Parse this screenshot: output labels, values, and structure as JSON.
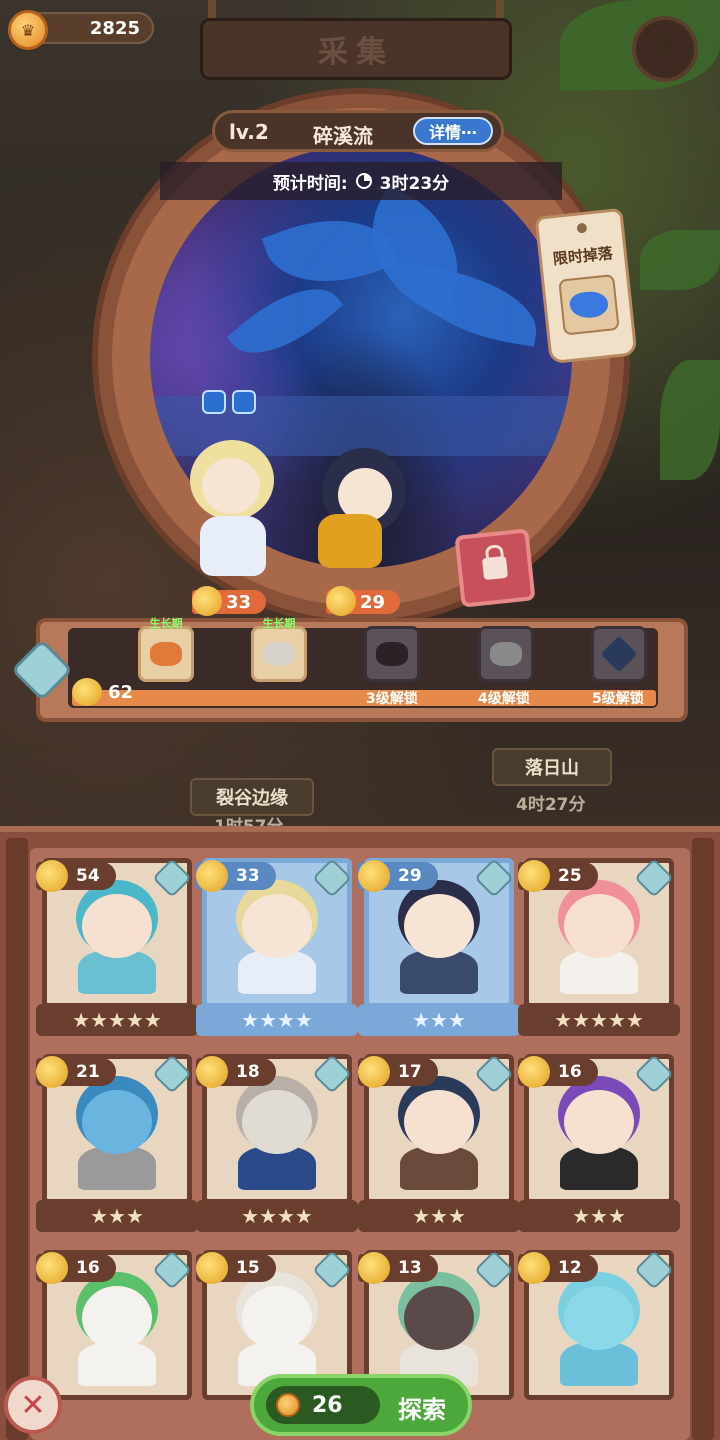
{
  "currency": {
    "coins": "2825"
  },
  "header": {
    "title": "采集",
    "help_icon": "question-icon"
  },
  "location": {
    "level": "lv.2",
    "name": "碎溪流",
    "detail_label": "详情⋯",
    "eta_label": "预计时间:",
    "eta_value": "3时23分",
    "limited_drop_label": "限时掉落"
  },
  "team": [
    {
      "power": "33"
    },
    {
      "power": "29"
    }
  ],
  "rewards": {
    "total_power": "62",
    "items": [
      {
        "stage": "生长期",
        "locked": false,
        "icon": "shell-icon",
        "color": "#e07a3a"
      },
      {
        "stage": "生长期",
        "locked": false,
        "icon": "ore-icon",
        "color": "#d8d4cc"
      },
      {
        "unlock": "3级解锁",
        "locked": true,
        "icon": "locked-item-icon"
      },
      {
        "unlock": "4级解锁",
        "locked": true,
        "icon": "locked-fish-icon"
      },
      {
        "unlock": "5级解锁",
        "locked": true,
        "icon": "locked-crystal-icon"
      }
    ]
  },
  "map": {
    "left_sign": "裂谷边缘",
    "left_time": "1时57分",
    "right_sign": "落日山",
    "right_time": "4时27分"
  },
  "characters": [
    {
      "power": "54",
      "stars": "★★★★★",
      "selected": false,
      "hair": "#4ab8c8",
      "skin": "#f8e0d0",
      "body": "#6ac0d0"
    },
    {
      "power": "33",
      "stars": "★★★★",
      "selected": true,
      "hair": "#e8d89a",
      "skin": "#f6e4d4",
      "body": "#e8eef8"
    },
    {
      "power": "29",
      "stars": "★★★",
      "selected": true,
      "hair": "#2a2e4a",
      "skin": "#f6e4d4",
      "body": "#3a4a6a"
    },
    {
      "power": "25",
      "stars": "★★★★★",
      "selected": false,
      "hair": "#f0909a",
      "skin": "#f8e0d0",
      "body": "#f4f0ec"
    },
    {
      "power": "21",
      "stars": "★★★",
      "selected": false,
      "hair": "#3a8ac0",
      "skin": "#6ab4e0",
      "body": "#9a9a9a"
    },
    {
      "power": "18",
      "stars": "★★★★",
      "selected": false,
      "hair": "#b8b0a8",
      "skin": "#e0dcd4",
      "body": "#2a4a8a"
    },
    {
      "power": "17",
      "stars": "★★★",
      "selected": false,
      "hair": "#2a3a5a",
      "skin": "#f6e0d0",
      "body": "#6a4a3a"
    },
    {
      "power": "16",
      "stars": "★★★",
      "selected": false,
      "hair": "#7a4ab8",
      "skin": "#f6e0d0",
      "body": "#2a2a2a"
    },
    {
      "power": "16",
      "stars": "",
      "selected": false,
      "hair": "#5ac06a",
      "skin": "#f4f2ee",
      "body": "#f4f2ee"
    },
    {
      "power": "15",
      "stars": "",
      "selected": false,
      "hair": "#e8e4dc",
      "skin": "#f4f2ee",
      "body": "#f4f2ee"
    },
    {
      "power": "13",
      "stars": "",
      "selected": false,
      "hair": "#7ac0a0",
      "skin": "#5a4a4a",
      "body": "#e8e4dc"
    },
    {
      "power": "12",
      "stars": "",
      "selected": false,
      "hair": "#7ad0e0",
      "skin": "#8ad8e8",
      "body": "#6ac0d8"
    }
  ],
  "footer": {
    "close_icon": "close-icon",
    "explore_cost": "26",
    "explore_label": "探索"
  }
}
